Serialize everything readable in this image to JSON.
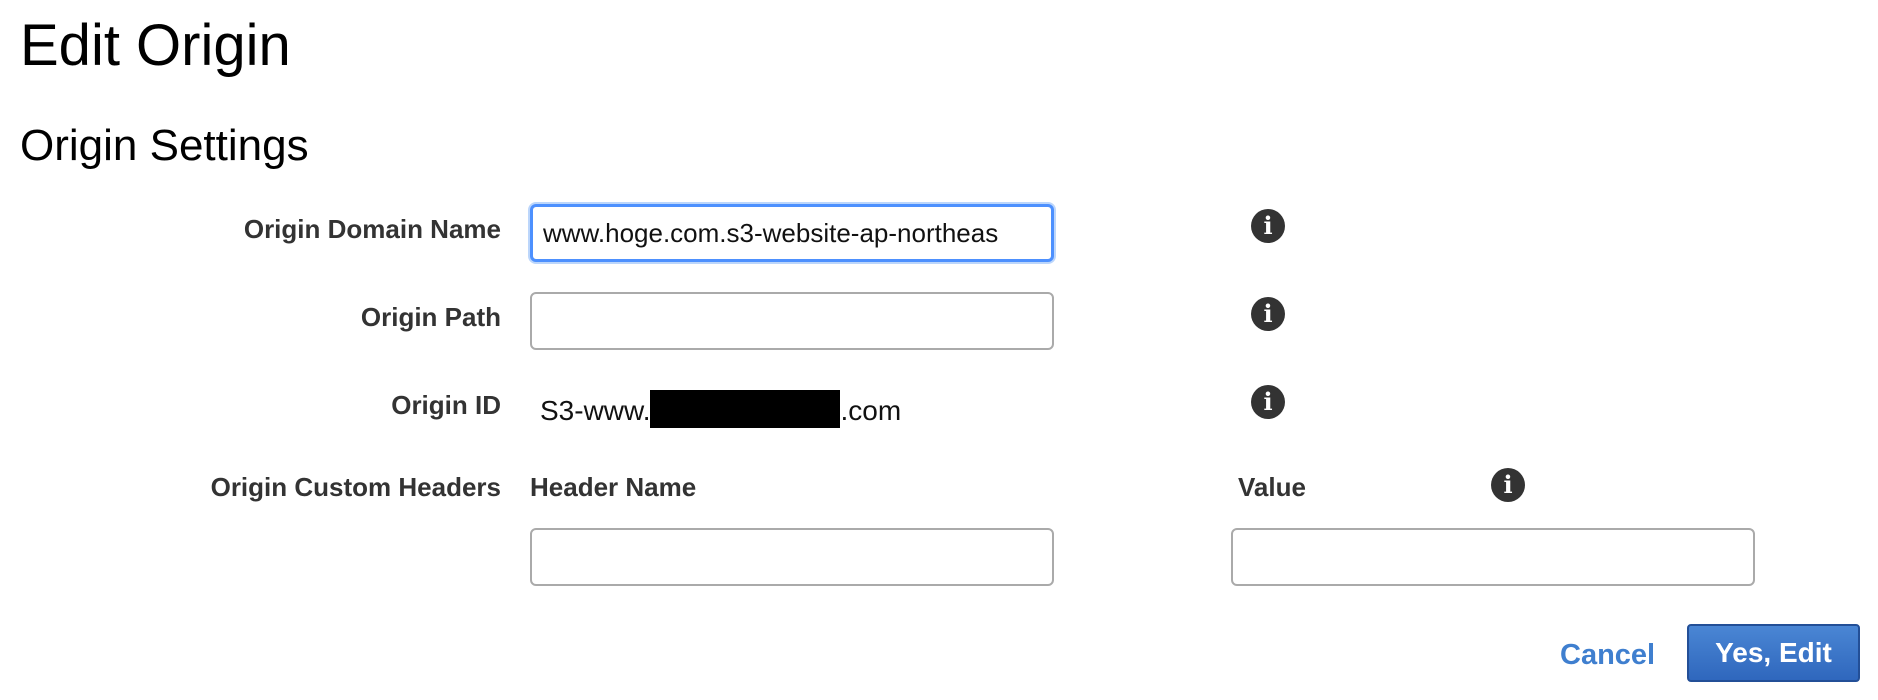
{
  "page": {
    "title": "Edit Origin"
  },
  "section": {
    "title": "Origin Settings"
  },
  "fields": {
    "origin_domain_name": {
      "label": "Origin Domain Name",
      "value": "www.hoge.com.s3-website-ap-northeas",
      "focused": true,
      "info_icon": "info-circle-icon"
    },
    "origin_path": {
      "label": "Origin Path",
      "value": "",
      "placeholder": "",
      "info_icon": "info-circle-icon"
    },
    "origin_id": {
      "label": "Origin ID",
      "value_prefix": "S3-www.",
      "value_suffix": ".com",
      "redacted": true,
      "info_icon": "info-circle-icon"
    },
    "origin_custom_headers": {
      "label": "Origin Custom Headers",
      "header_name_label": "Header Name",
      "value_label": "Value",
      "header_name_value": "",
      "value_value": "",
      "info_icon": "info-circle-icon"
    }
  },
  "actions": {
    "cancel_label": "Cancel",
    "submit_label": "Yes, Edit"
  },
  "icons": {
    "info": "i"
  },
  "colors": {
    "focus_border": "#4d90fe",
    "link": "#3f7fcf",
    "primary_button": "#2f67bd",
    "icon": "#333333"
  }
}
